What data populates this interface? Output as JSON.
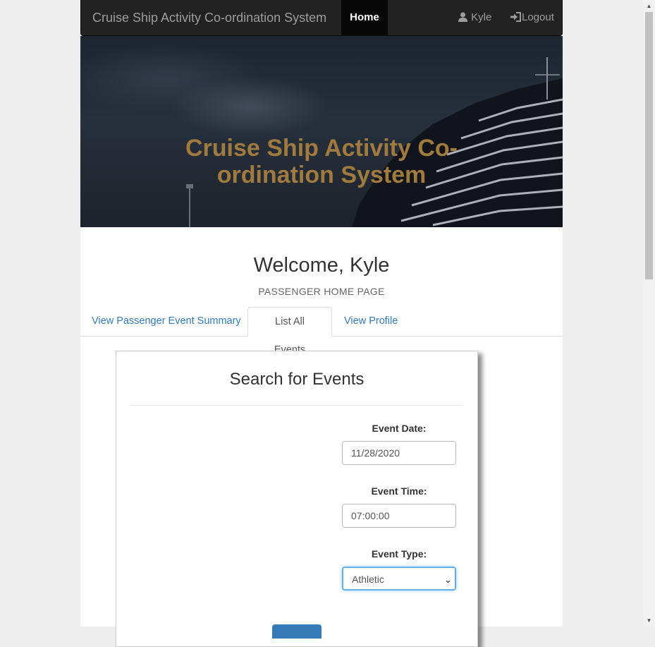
{
  "navbar": {
    "brand": "Cruise Ship Activity Co-ordination System",
    "home": "Home",
    "user": "Kyle",
    "logout": "Logout"
  },
  "hero": {
    "title_line1": "Cruise Ship Activity Co-",
    "title_line2": "ordination System"
  },
  "welcome": "Welcome, Kyle",
  "subtitle": "PASSENGER HOME PAGE",
  "tabs": [
    {
      "label": "View Passenger Event Summary"
    },
    {
      "label": "List All Events"
    },
    {
      "label": "View Profile"
    }
  ],
  "search": {
    "title": "Search for Events",
    "date_label": "Event Date:",
    "date_value": "11/28/2020",
    "time_label": "Event Time:",
    "time_value": "07:00:00",
    "type_label": "Event Type:",
    "type_value": "Athletic"
  },
  "colors": {
    "navbar_bg": "#222222",
    "hero_title": "#a07a3e",
    "link": "#337ab7"
  },
  "icons": {
    "user": "user-icon",
    "logout": "log-in-icon",
    "select": "chevron-down-icon"
  }
}
